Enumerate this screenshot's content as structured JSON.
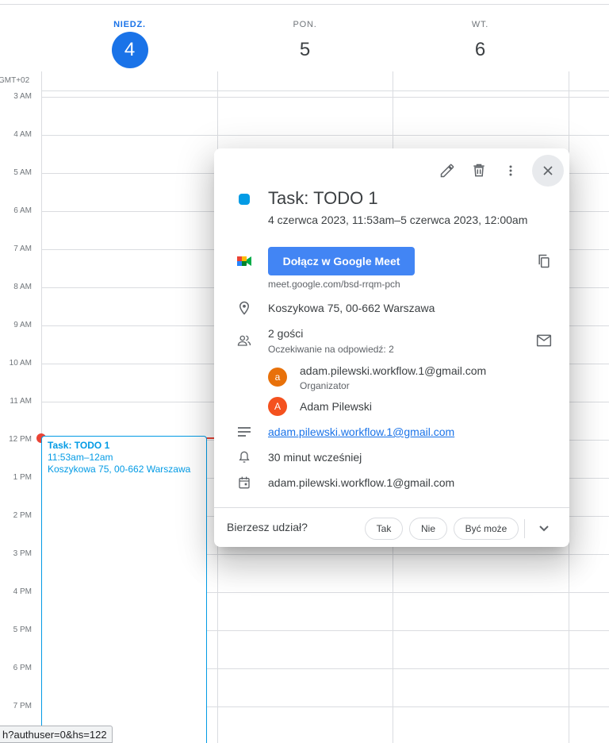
{
  "header": {
    "days": [
      {
        "name": "NIEDZ.",
        "number": "4",
        "today": true
      },
      {
        "name": "PON.",
        "number": "5",
        "today": false
      },
      {
        "name": "WT.",
        "number": "6",
        "today": false
      }
    ],
    "timezone": "GMT+02"
  },
  "hours": [
    "3 AM",
    "4 AM",
    "5 AM",
    "6 AM",
    "7 AM",
    "8 AM",
    "9 AM",
    "10 AM",
    "11 AM",
    "12 PM",
    "1 PM",
    "2 PM",
    "3 PM",
    "4 PM",
    "5 PM",
    "6 PM",
    "7 PM"
  ],
  "event": {
    "title": "Task: TODO 1",
    "time": "11:53am–12am",
    "location": "Koszykowa 75, 00-662 Warszawa",
    "color": "#039be5"
  },
  "status_bar": {
    "url": "h?authuser=0&hs=122"
  },
  "popup": {
    "title": "Task: TODO 1",
    "datetime": "4 czerwca 2023, 11:53am–5 czerwca 2023, 12:00am",
    "meet_button": "Dołącz w Google Meet",
    "meet_link": "meet.google.com/bsd-rrqm-pch",
    "location": "Koszykowa 75, 00-662 Warszawa",
    "guests_count": "2 gości",
    "guests_waiting": "Oczekiwanie na odpowiedź: 2",
    "guests": [
      {
        "initial": "a",
        "name": "adam.pilewski.workflow.1@gmail.com",
        "role": "Organizator",
        "color": "#e8710a"
      },
      {
        "initial": "A",
        "name": "Adam Pilewski",
        "role": "",
        "color": "#f4511e"
      }
    ],
    "description": "adam.pilewski.workflow.1@gmail.com",
    "reminder": "30 minut wcześniej",
    "calendar": "adam.pilewski.workflow.1@gmail.com",
    "rsvp": {
      "label": "Bierzesz udział?",
      "yes": "Tak",
      "no": "Nie",
      "maybe": "Być może"
    }
  },
  "icons": [
    "edit-icon",
    "delete-icon",
    "more-vert-icon",
    "close-icon",
    "google-meet-icon",
    "copy-icon",
    "location-icon",
    "people-icon",
    "mail-icon",
    "notes-icon",
    "bell-icon",
    "calendar-icon",
    "chevron-down-icon"
  ]
}
